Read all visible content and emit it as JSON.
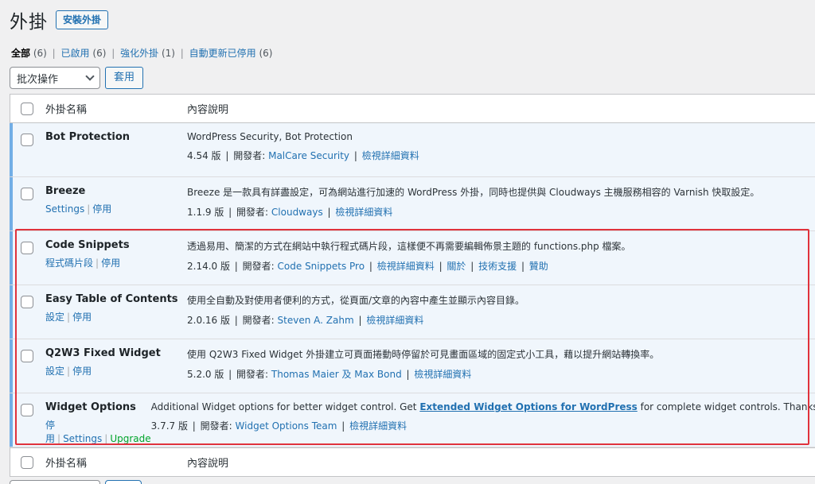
{
  "header": {
    "title": "外掛",
    "add_button": "安裝外掛"
  },
  "filters": [
    {
      "label": "全部",
      "count": "(6)",
      "current": true
    },
    {
      "label": "已啟用",
      "count": "(6)"
    },
    {
      "label": "強化外掛",
      "count": "(1)"
    },
    {
      "label": "自動更新已停用",
      "count": "(6)"
    }
  ],
  "bulk": {
    "select_value": "批次操作",
    "apply_label": "套用"
  },
  "table": {
    "col_name": "外掛名稱",
    "col_desc": "內容說明"
  },
  "plugins": [
    {
      "name": "Bot Protection",
      "actions": [],
      "description": "WordPress Security, Bot Protection",
      "version": "4.54 版",
      "by": "開發者:",
      "author": "MalCare Security",
      "links": [
        "檢視詳細資料"
      ]
    },
    {
      "name": "Breeze",
      "actions": [
        "Settings",
        "停用"
      ],
      "description": "Breeze 是一款具有詳盡設定，可為網站進行加速的 WordPress 外掛，同時也提供與 Cloudways 主機服務相容的 Varnish 快取設定。",
      "version": "1.1.9 版",
      "by": "開發者:",
      "author": "Cloudways",
      "links": [
        "檢視詳細資料"
      ]
    },
    {
      "name": "Code Snippets",
      "actions": [
        "程式碼片段",
        "停用"
      ],
      "description": "透過易用、簡潔的方式在網站中執行程式碼片段，這樣便不再需要編輯佈景主題的 functions.php 檔案。",
      "version": "2.14.0 版",
      "by": "開發者:",
      "author": "Code Snippets Pro",
      "links": [
        "檢視詳細資料",
        "關於",
        "技術支援",
        "贊助"
      ]
    },
    {
      "name": "Easy Table of Contents",
      "actions": [
        "設定",
        "停用"
      ],
      "description": "使用全自動及對使用者便利的方式，從頁面/文章的內容中產生並顯示內容目錄。",
      "version": "2.0.16 版",
      "by": "開發者:",
      "author": "Steven A. Zahm",
      "links": [
        "檢視詳細資料"
      ]
    },
    {
      "name": "Q2W3 Fixed Widget",
      "actions": [
        "設定",
        "停用"
      ],
      "description": "使用 Q2W3 Fixed Widget 外掛建立可頁面捲動時停留於可見畫面區域的固定式小工具，藉以提升網站轉換率。",
      "version": "5.2.0 版",
      "by": "開發者:",
      "author": "Thomas Maier 及 Max Bond",
      "links": [
        "檢視詳細資料"
      ]
    },
    {
      "name": "Widget Options",
      "actions": [
        "停用",
        "Settings",
        "Upgrade"
      ],
      "description_pre": "Additional Widget options for better widget control. Get ",
      "description_link": "Extended Widget Options for WordPress",
      "description_post": " for complete widget controls. Thanks!",
      "version": "3.7.7 版",
      "by": "開發者:",
      "author": "Widget Options Team",
      "links": [
        "檢視詳細資料"
      ]
    }
  ],
  "colors": {
    "link": "#2271b1",
    "active_bar": "#72aee6",
    "row_bg": "#f0f6fc",
    "highlight": "#e0323c",
    "upgrade": "#00a32a"
  }
}
